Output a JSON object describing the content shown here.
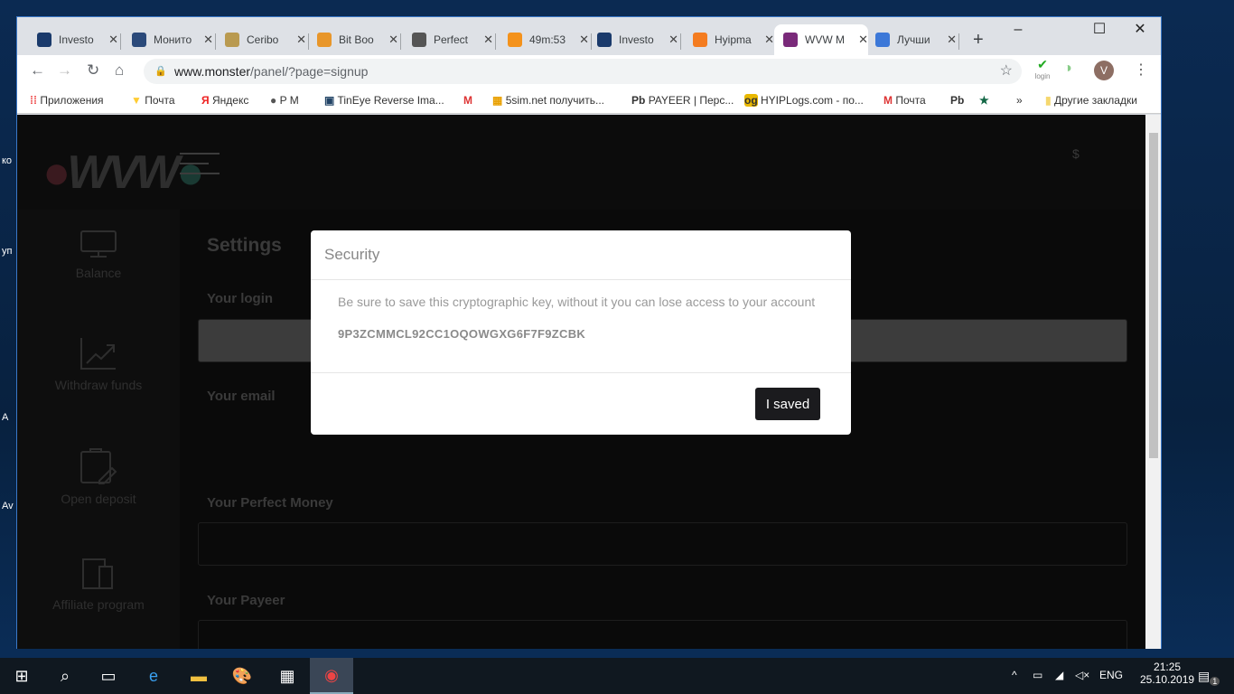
{
  "desktop": {
    "labels": [
      "ко",
      "уп",
      "А",
      "Av"
    ]
  },
  "browser": {
    "tabs": [
      {
        "title": "Investo",
        "color": "#1a3a6b"
      },
      {
        "title": "Монито",
        "color": "#2b4a7a"
      },
      {
        "title": "Ceribo",
        "color": "#b99a50"
      },
      {
        "title": "Bit Boo",
        "color": "#e8962a"
      },
      {
        "title": "Perfect",
        "color": "#555"
      },
      {
        "title": "49m:53",
        "color": "#f4921b"
      },
      {
        "title": "Investo",
        "color": "#1a3a6b"
      },
      {
        "title": "Hyipma",
        "color": "#f47c20"
      },
      {
        "title": "WVW M",
        "color": "#7a2a7a",
        "active": true
      },
      {
        "title": "Лучши",
        "color": "#3c78d8"
      }
    ],
    "new_tab": "+",
    "window_controls": {
      "minimize": "–",
      "maximize": "☐",
      "close": "✕"
    },
    "url_host": "www.monster",
    "url_path": "/panel/?page=signup",
    "profile_initial": "V",
    "ext_login": "login",
    "bookmarks": [
      "Приложения",
      "Почта",
      "Яндекс",
      "P M",
      "TinEye Reverse Ima...",
      "5sim.net получить...",
      "PAYEER | Перс...",
      "HYIPLogs.com - по...",
      "Почта",
      "»",
      "Другие закладки"
    ]
  },
  "page": {
    "logo": "WVW",
    "currency": "$",
    "sidebar": [
      "Balance",
      "Withdraw funds",
      "Open deposit",
      "Affiliate program"
    ],
    "title": "Settings",
    "labels": {
      "login": "Your login",
      "email": "Your email",
      "pm": "Your Perfect Money",
      "payeer": "Your Payeer"
    }
  },
  "modal": {
    "title": "Security",
    "message": "Be sure to save this cryptographic key, without it you can lose access to your account",
    "key": "9P3ZCMMCL92CC1OQOWGXG6F7F9ZCBK",
    "button": "I saved"
  },
  "taskbar": {
    "lang": "ENG",
    "time": "21:25",
    "date": "25.10.2019",
    "notifications": "1"
  }
}
